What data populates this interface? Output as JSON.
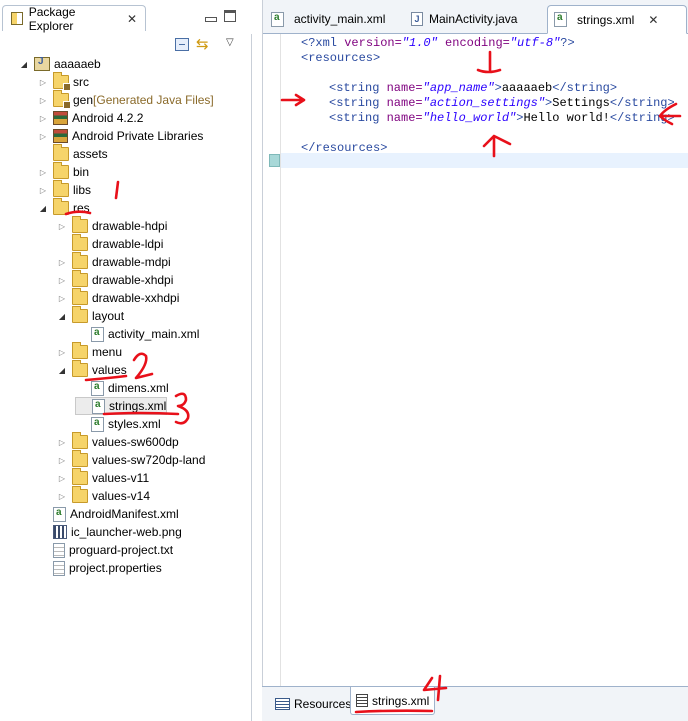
{
  "explorer": {
    "title": "Package Explorer",
    "close": "✕",
    "tree": [
      {
        "label": "aaaaaeb",
        "icon": "project-icon",
        "twisty": "open"
      },
      {
        "label": "src",
        "icon": "folder-package-icon",
        "twisty": "closed"
      },
      {
        "label": "gen",
        "extra": " [Generated Java Files]",
        "icon": "folder-package-icon",
        "twisty": "closed"
      },
      {
        "label": "Android 4.2.2",
        "icon": "library-icon",
        "twisty": "closed"
      },
      {
        "label": "Android Private Libraries",
        "icon": "library-icon",
        "twisty": "closed"
      },
      {
        "label": "assets",
        "icon": "folder-icon",
        "twisty": "none"
      },
      {
        "label": "bin",
        "icon": "folder-icon",
        "twisty": "closed"
      },
      {
        "label": "libs",
        "icon": "folder-icon",
        "twisty": "closed"
      },
      {
        "label": "res",
        "icon": "folder-icon",
        "twisty": "open"
      },
      {
        "label": "drawable-hdpi",
        "icon": "folder-icon",
        "twisty": "closed"
      },
      {
        "label": "drawable-ldpi",
        "icon": "folder-icon",
        "twisty": "none"
      },
      {
        "label": "drawable-mdpi",
        "icon": "folder-icon",
        "twisty": "closed"
      },
      {
        "label": "drawable-xhdpi",
        "icon": "folder-icon",
        "twisty": "closed"
      },
      {
        "label": "drawable-xxhdpi",
        "icon": "folder-icon",
        "twisty": "closed"
      },
      {
        "label": "layout",
        "icon": "folder-icon",
        "twisty": "open"
      },
      {
        "label": "activity_main.xml",
        "icon": "xml-file-icon",
        "twisty": "none"
      },
      {
        "label": "menu",
        "icon": "folder-icon",
        "twisty": "closed"
      },
      {
        "label": "values",
        "icon": "folder-icon",
        "twisty": "open"
      },
      {
        "label": "dimens.xml",
        "icon": "xml-file-icon",
        "twisty": "none"
      },
      {
        "label": "strings.xml",
        "icon": "xml-file-icon",
        "twisty": "none",
        "selected": true
      },
      {
        "label": "styles.xml",
        "icon": "xml-file-icon",
        "twisty": "none"
      },
      {
        "label": "values-sw600dp",
        "icon": "folder-icon",
        "twisty": "closed"
      },
      {
        "label": "values-sw720dp-land",
        "icon": "folder-icon",
        "twisty": "closed"
      },
      {
        "label": "values-v11",
        "icon": "folder-icon",
        "twisty": "closed"
      },
      {
        "label": "values-v14",
        "icon": "folder-icon",
        "twisty": "closed"
      },
      {
        "label": "AndroidManifest.xml",
        "icon": "xml-file-icon",
        "twisty": "none"
      },
      {
        "label": "ic_launcher-web.png",
        "icon": "image-file-icon",
        "twisty": "none"
      },
      {
        "label": "proguard-project.txt",
        "icon": "text-file-icon",
        "twisty": "none"
      },
      {
        "label": "project.properties",
        "icon": "text-file-icon",
        "twisty": "none"
      }
    ]
  },
  "editor": {
    "tabs": [
      {
        "label": "activity_main.xml",
        "icon": "xml-file-icon",
        "active": false
      },
      {
        "label": "MainActivity.java",
        "icon": "java-file-icon",
        "active": false
      },
      {
        "label": "strings.xml",
        "icon": "xml-file-icon",
        "active": true
      }
    ],
    "close": "✕",
    "code": {
      "decl_open": "<?xml ",
      "decl_version_attr": "version=",
      "decl_version_val": "\"1.0\"",
      "decl_encoding_attr": " encoding=",
      "decl_encoding_val": "\"utf-8\"",
      "decl_close": "?>",
      "resources_open": "<resources>",
      "strings": [
        {
          "open": "<string ",
          "attr": "name=",
          "value": "\"app_name\"",
          "gt": ">",
          "text": "aaaaaeb",
          "close": "</string>"
        },
        {
          "open": "<string ",
          "attr": "name=",
          "value": "\"action_settings\"",
          "gt": ">",
          "text": "Settings",
          "close": "</string>"
        },
        {
          "open": "<string ",
          "attr": "name=",
          "value": "\"hello_world\"",
          "gt": ">",
          "text": "Hello world!",
          "close": "</string>"
        }
      ],
      "resources_close": "</resources>"
    },
    "bottom_tabs": [
      {
        "label": "Resources",
        "icon": "resources-icon",
        "active": false
      },
      {
        "label": "strings.xml",
        "icon": "source-icon",
        "active": true
      }
    ]
  },
  "annotations": {
    "color": "#e8101a",
    "numbers": [
      "1",
      "2",
      "3",
      "4"
    ]
  }
}
